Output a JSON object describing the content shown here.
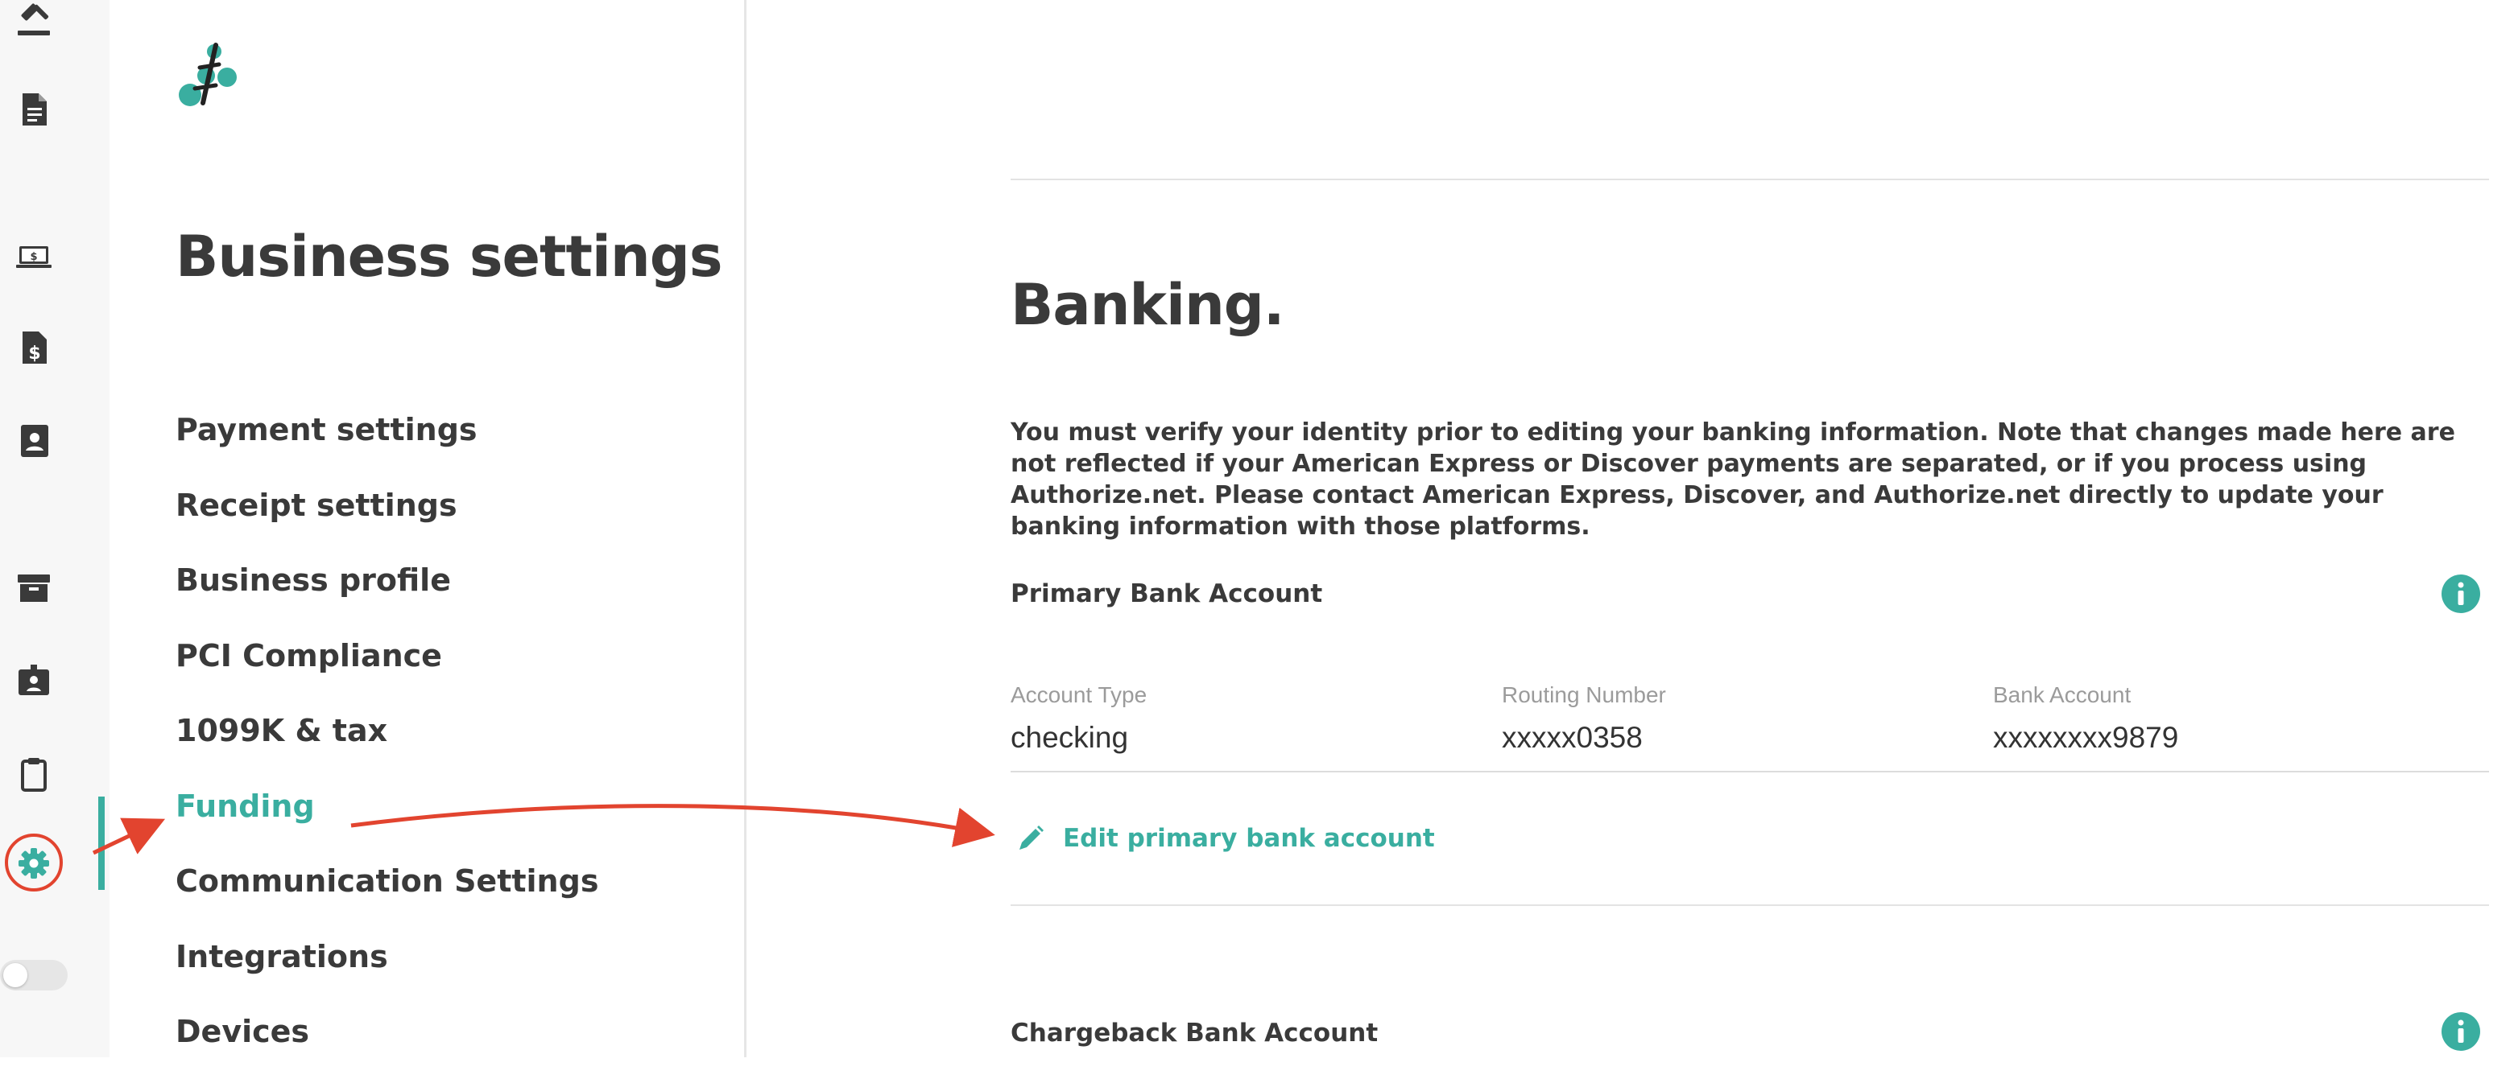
{
  "colors": {
    "accent": "#3aaea0",
    "text": "#3a3a3a",
    "muted": "#9b9b9b",
    "annotation": "#e2442f"
  },
  "rail": {
    "icons": [
      "gavel-icon",
      "document-icon",
      "laptop-dollar-icon",
      "invoice-dollar-icon",
      "contact-card-icon",
      "archive-box-icon",
      "id-badge-icon",
      "clipboard-icon",
      "gear-icon"
    ],
    "active": "gear-icon",
    "toggle_on": false
  },
  "nav": {
    "title": "Business settings",
    "items": [
      {
        "label": "Payment settings"
      },
      {
        "label": "Receipt settings"
      },
      {
        "label": "Business profile"
      },
      {
        "label": "PCI Compliance"
      },
      {
        "label": "1099K & tax"
      },
      {
        "label": "Funding",
        "active": true
      },
      {
        "label": "Communication Settings"
      },
      {
        "label": "Integrations"
      },
      {
        "label": "Devices"
      }
    ]
  },
  "main": {
    "title": "Banking.",
    "notice": "You must verify your identity prior to editing your banking information. Note that changes made here are not reflected if your American Express or Discover payments are separated, or if you process using Authorize.net. Please contact American Express, Discover, and Authorize.net directly to update your banking information with those platforms.",
    "primary": {
      "label": "Primary Bank Account",
      "fields": [
        {
          "label": "Account Type",
          "value": "checking"
        },
        {
          "label": "Routing Number",
          "value": "xxxxx0358"
        },
        {
          "label": "Bank Account",
          "value": "xxxxxxxx9879"
        }
      ],
      "edit_label": "Edit primary bank account"
    },
    "chargeback": {
      "label": "Chargeback Bank Account"
    }
  }
}
